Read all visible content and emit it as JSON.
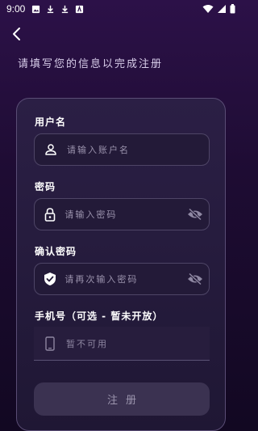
{
  "status_bar": {
    "time": "9:00",
    "left_icons": [
      "image-icon",
      "download-icon",
      "download-icon",
      "text-icon"
    ],
    "right_icons": [
      "wifi-icon",
      "signal-icon",
      "battery-icon"
    ]
  },
  "header": {
    "back_icon": "chevron-left-icon",
    "subtitle": "请填写您的信息以完成注册"
  },
  "form": {
    "username": {
      "label": "用户名",
      "placeholder": "请输入账户名",
      "value": "",
      "icon": "person-icon"
    },
    "password": {
      "label": "密码",
      "placeholder": "请输入密码",
      "value": "",
      "icon": "lock-icon",
      "toggle_icon": "eye-off-icon"
    },
    "confirm_password": {
      "label": "确认密码",
      "placeholder": "请再次输入密码",
      "value": "",
      "icon": "shield-check-icon",
      "toggle_icon": "eye-off-icon"
    },
    "phone": {
      "label": "手机号（可选 - 暂未开放）",
      "text": "暂不可用",
      "icon": "phone-icon"
    },
    "submit_label": "注册"
  },
  "colors": {
    "background_top": "#2c1148",
    "background_bottom": "#120822",
    "card": "#2b1f45",
    "button": "#3b3251"
  }
}
